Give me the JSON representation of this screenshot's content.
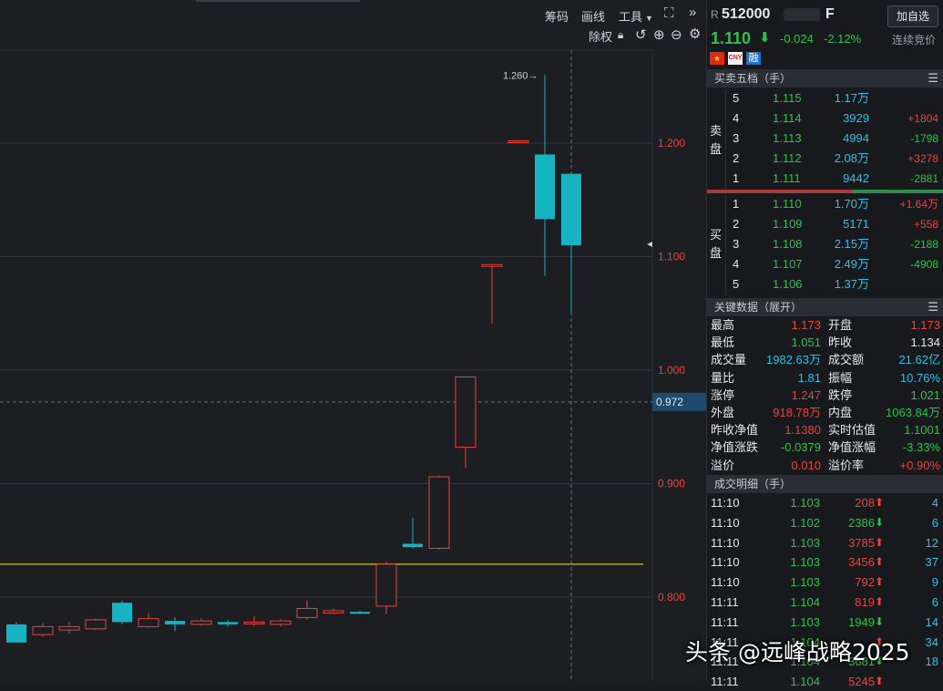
{
  "toolbar": {
    "chips_label": "筹码",
    "draw_label": "画线",
    "tools_label": "工具",
    "fq_label": "除权"
  },
  "price_axis": {
    "labels": [
      "1.200",
      "1.100",
      "1.000",
      "0.900",
      "0.800"
    ],
    "current_tag": "0.972",
    "high_label": "1.260"
  },
  "chart_data": {
    "type": "candlestick",
    "ylim": [
      0.765,
      1.29
    ],
    "candles": [
      {
        "o": 0.776,
        "c": 0.76,
        "h": 0.778,
        "l": 0.76,
        "color": "cyan"
      },
      {
        "o": 0.767,
        "c": 0.774,
        "h": 0.777,
        "l": 0.765,
        "color": "red"
      },
      {
        "o": 0.771,
        "c": 0.774,
        "h": 0.778,
        "l": 0.768,
        "color": "red"
      },
      {
        "o": 0.772,
        "c": 0.78,
        "h": 0.781,
        "l": 0.771,
        "color": "red"
      },
      {
        "o": 0.795,
        "c": 0.778,
        "h": 0.797,
        "l": 0.776,
        "color": "cyan"
      },
      {
        "o": 0.774,
        "c": 0.781,
        "h": 0.786,
        "l": 0.773,
        "color": "red"
      },
      {
        "o": 0.779,
        "c": 0.776,
        "h": 0.782,
        "l": 0.77,
        "color": "cyan"
      },
      {
        "o": 0.776,
        "c": 0.779,
        "h": 0.781,
        "l": 0.775,
        "color": "red"
      },
      {
        "o": 0.778,
        "c": 0.776,
        "h": 0.78,
        "l": 0.774,
        "color": "cyan"
      },
      {
        "o": 0.777,
        "c": 0.778,
        "h": 0.783,
        "l": 0.775,
        "color": "red"
      },
      {
        "o": 0.776,
        "c": 0.779,
        "h": 0.781,
        "l": 0.774,
        "color": "red"
      },
      {
        "o": 0.782,
        "c": 0.79,
        "h": 0.797,
        "l": 0.78,
        "color": "red"
      },
      {
        "o": 0.786,
        "c": 0.788,
        "h": 0.79,
        "l": 0.785,
        "color": "red"
      },
      {
        "o": 0.787,
        "c": 0.786,
        "h": 0.788,
        "l": 0.785,
        "color": "cyan"
      },
      {
        "o": 0.792,
        "c": 0.829,
        "h": 0.831,
        "l": 0.785,
        "color": "red"
      },
      {
        "o": 0.847,
        "c": 0.844,
        "h": 0.87,
        "l": 0.843,
        "color": "cyan"
      },
      {
        "o": 0.843,
        "c": 0.906,
        "h": 0.907,
        "l": 0.842,
        "color": "red"
      },
      {
        "o": 0.932,
        "c": 0.994,
        "h": 0.994,
        "l": 0.914,
        "color": "red"
      },
      {
        "o": 1.093,
        "c": 1.093,
        "h": 1.093,
        "l": 1.041,
        "color": "red"
      },
      {
        "o": 1.202,
        "c": 1.202,
        "h": 1.202,
        "l": 1.202,
        "color": "red"
      },
      {
        "o": 1.19,
        "c": 1.133,
        "h": 1.26,
        "l": 1.083,
        "color": "cyan"
      },
      {
        "o": 1.173,
        "c": 1.11,
        "h": 1.173,
        "l": 1.051,
        "color": "cyan"
      }
    ],
    "hline": 0.829
  },
  "quote": {
    "badge": "R",
    "code": "512000",
    "suffix": "F",
    "add_watch": "加自选",
    "price": "1.110",
    "change": "-0.024",
    "pct": "-2.12%",
    "status": "连续竞价",
    "tag_rz": "融"
  },
  "book": {
    "title": "买卖五档（手）",
    "sell_label": "卖盘",
    "buy_label": "买盘",
    "sell": [
      {
        "lv": "5",
        "price": "1.115",
        "vol": "1.17万",
        "chg": ""
      },
      {
        "lv": "4",
        "price": "1.114",
        "vol": "3929",
        "chg": "+1804"
      },
      {
        "lv": "3",
        "price": "1.113",
        "vol": "4994",
        "chg": "-1798"
      },
      {
        "lv": "2",
        "price": "1.112",
        "vol": "2.08万",
        "chg": "+3278"
      },
      {
        "lv": "1",
        "price": "1.111",
        "vol": "9442",
        "chg": "-2881"
      }
    ],
    "buy": [
      {
        "lv": "1",
        "price": "1.110",
        "vol": "1.70万",
        "chg": "+1.64万"
      },
      {
        "lv": "2",
        "price": "1.109",
        "vol": "5171",
        "chg": "+558"
      },
      {
        "lv": "3",
        "price": "1.108",
        "vol": "2.15万",
        "chg": "-2188"
      },
      {
        "lv": "4",
        "price": "1.107",
        "vol": "2.49万",
        "chg": "-4908"
      },
      {
        "lv": "5",
        "price": "1.106",
        "vol": "1.37万",
        "chg": ""
      }
    ]
  },
  "keydata": {
    "title": "关键数据（展开）",
    "rows": [
      {
        "l1": "最高",
        "v1": "1.173",
        "c1": "red",
        "l2": "开盘",
        "v2": "1.173",
        "c2": "red"
      },
      {
        "l1": "最低",
        "v1": "1.051",
        "c1": "grn",
        "l2": "昨收",
        "v2": "1.134",
        "c2": "wht"
      },
      {
        "l1": "成交量",
        "v1": "1982.63万",
        "c1": "cyan",
        "l2": "成交额",
        "v2": "21.62亿",
        "c2": "cyan"
      },
      {
        "l1": "量比",
        "v1": "1.81",
        "c1": "cyan",
        "l2": "振幅",
        "v2": "10.76%",
        "c2": "cyan"
      },
      {
        "l1": "涨停",
        "v1": "1.247",
        "c1": "red",
        "l2": "跌停",
        "v2": "1.021",
        "c2": "grn"
      },
      {
        "l1": "外盘",
        "v1": "918.78万",
        "c1": "red",
        "l2": "内盘",
        "v2": "1063.84万",
        "c2": "grn"
      },
      {
        "l1": "昨收净值",
        "v1": "1.1380",
        "c1": "red",
        "l2": "实时估值",
        "v2": "1.1001",
        "c2": "grn"
      },
      {
        "l1": "净值涨跌",
        "v1": "-0.0379",
        "c1": "grn",
        "l2": "净值涨幅",
        "v2": "-3.33%",
        "c2": "grn"
      },
      {
        "l1": "溢价",
        "v1": "0.010",
        "c1": "red",
        "l2": "溢价率",
        "v2": "+0.90%",
        "c2": "red"
      }
    ]
  },
  "ticks": {
    "title": "成交明细（手）",
    "rows": [
      {
        "t": "11:10",
        "p": "1.103",
        "v": "208",
        "dir": "up",
        "n": "4"
      },
      {
        "t": "11:10",
        "p": "1.102",
        "v": "2386",
        "dir": "down",
        "n": "6"
      },
      {
        "t": "11:10",
        "p": "1.103",
        "v": "3785",
        "dir": "up",
        "n": "12"
      },
      {
        "t": "11:10",
        "p": "1.103",
        "v": "3456",
        "dir": "up",
        "n": "37"
      },
      {
        "t": "11:10",
        "p": "1.103",
        "v": "792",
        "dir": "up",
        "n": "9"
      },
      {
        "t": "11:11",
        "p": "1.104",
        "v": "819",
        "dir": "up",
        "n": "6"
      },
      {
        "t": "11:11",
        "p": "1.103",
        "v": "1949",
        "dir": "down",
        "n": "14"
      },
      {
        "t": "11:11",
        "p": "1.104",
        "v": "",
        "dir": "up",
        "n": "34"
      },
      {
        "t": "11:11",
        "p": "1.104",
        "v": "3681",
        "dir": "down",
        "n": "18"
      },
      {
        "t": "11:11",
        "p": "1.104",
        "v": "5245",
        "dir": "up",
        "n": ""
      }
    ]
  },
  "watermark": "头条 @远峰战略2025"
}
